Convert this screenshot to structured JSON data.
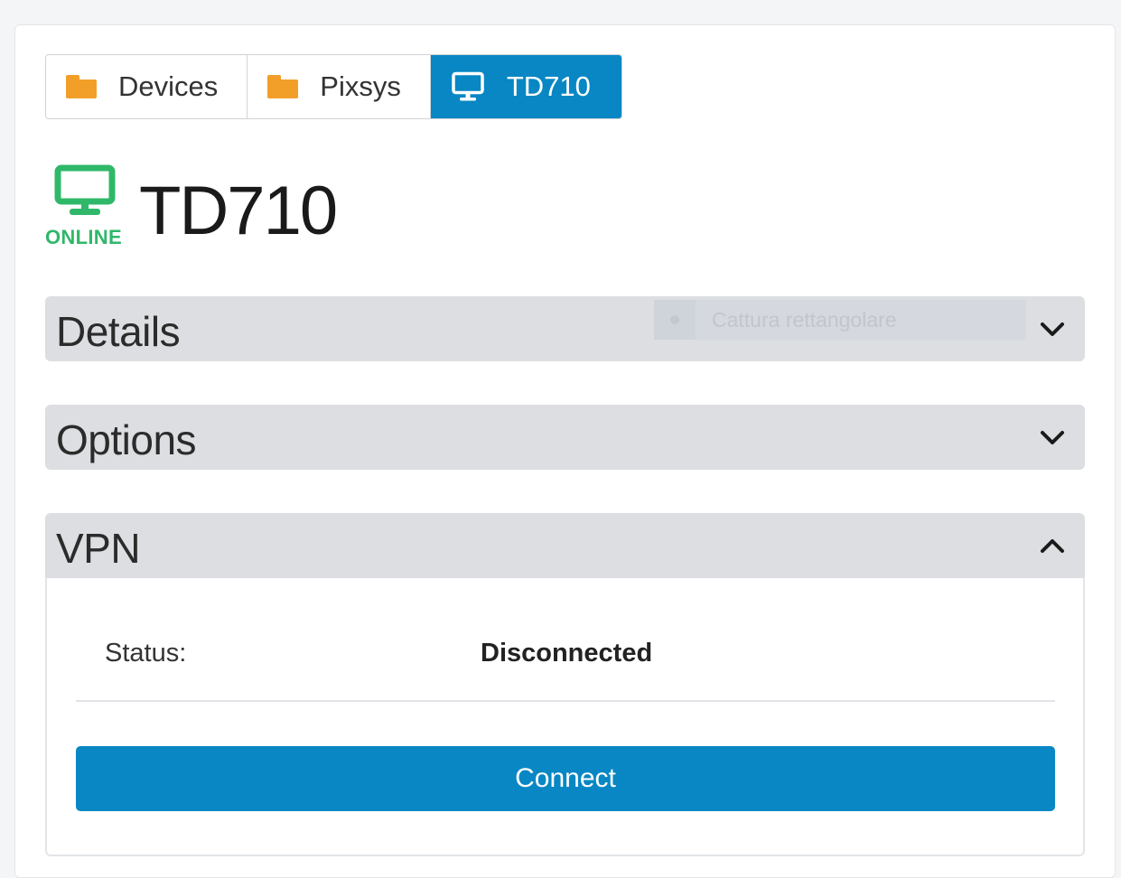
{
  "breadcrumb": {
    "items": [
      {
        "label": "Devices",
        "icon": "folder-icon"
      },
      {
        "label": "Pixsys",
        "icon": "folder-icon"
      },
      {
        "label": "TD710",
        "icon": "monitor-icon",
        "active": true
      }
    ]
  },
  "device": {
    "name": "TD710",
    "status": "ONLINE",
    "status_color": "#2fb86a"
  },
  "sections": {
    "details": {
      "title": "Details",
      "expanded": false
    },
    "options": {
      "title": "Options",
      "expanded": false
    },
    "vpn": {
      "title": "VPN",
      "expanded": true
    }
  },
  "overlay": {
    "text": "Cattura rettangolare"
  },
  "vpn": {
    "status_label": "Status:",
    "status_value": "Disconnected",
    "connect_label": "Connect"
  },
  "colors": {
    "accent": "#0887c4",
    "folder": "#f29f2a",
    "online": "#2fb86a",
    "section_bg": "#dcdee1"
  }
}
